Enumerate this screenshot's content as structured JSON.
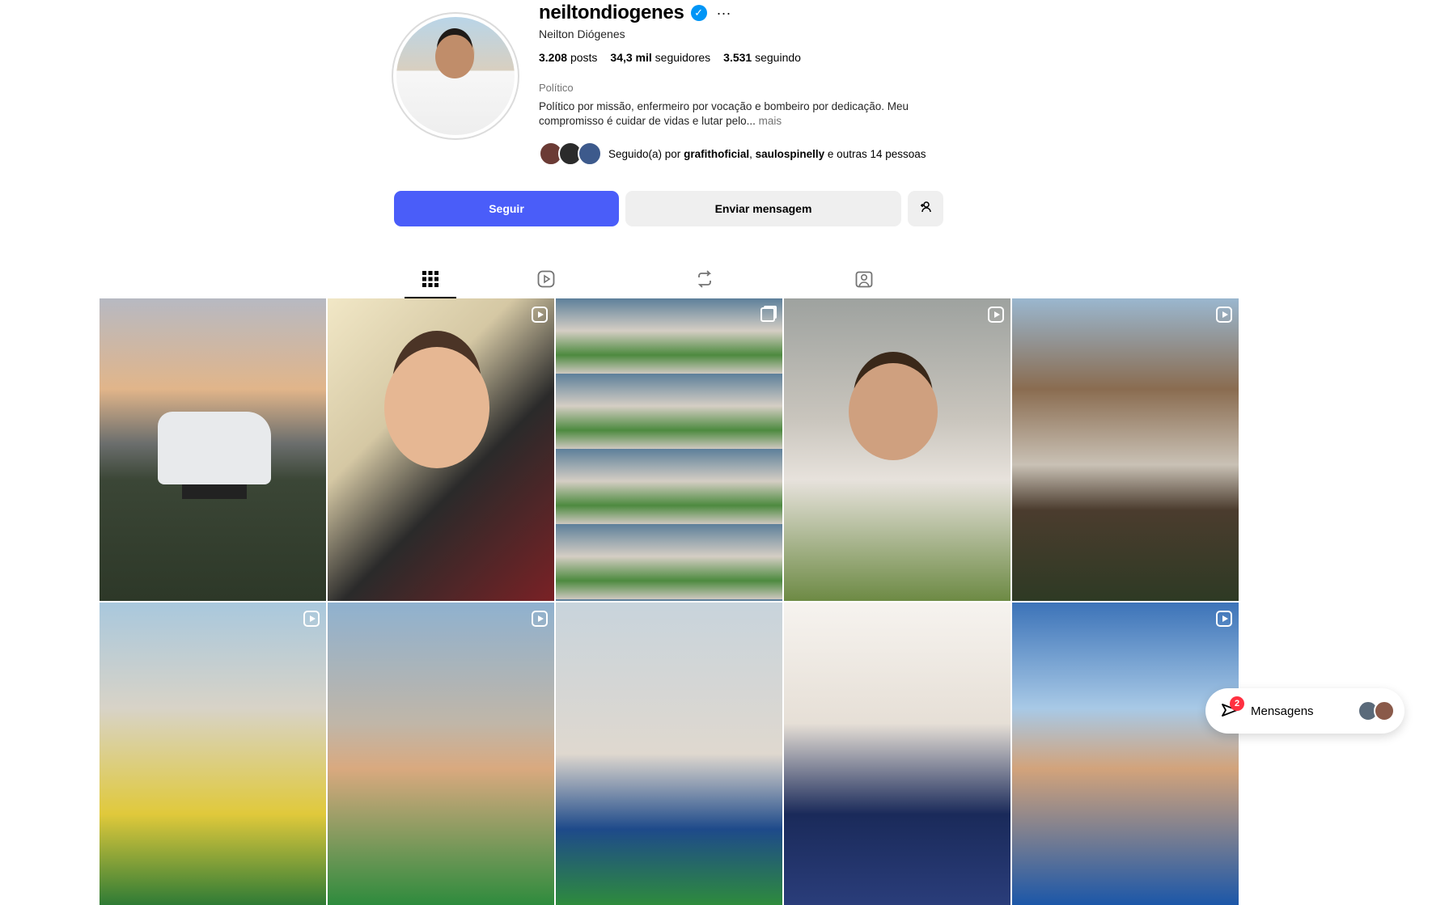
{
  "profile": {
    "username": "neiltondiogenes",
    "full_name": "Neilton Diógenes",
    "stats": [
      {
        "value": "3.208",
        "label": "posts"
      },
      {
        "value": "34,3 mil",
        "label": "seguidores"
      },
      {
        "value": "3.531",
        "label": "seguindo"
      }
    ],
    "category": "Político",
    "bio": "Político por missão, enfermeiro por vocação e bombeiro por dedicação. Meu compromisso é cuidar de vidas e lutar pelo...",
    "bio_more": "mais",
    "followed_by": {
      "prefix": "Seguido(a) por",
      "user1": "grafithoficial",
      "sep": ",",
      "user2": "saulospinelly",
      "suffix": "e outras 14 pessoas"
    }
  },
  "actions": {
    "follow": "Seguir",
    "message": "Enviar mensagem",
    "suggest_icon": "person-add-icon"
  },
  "tabs": [
    {
      "icon": "grid-icon",
      "active": true
    },
    {
      "icon": "reels-icon",
      "active": false
    },
    {
      "icon": "reposts-icon",
      "active": false
    },
    {
      "icon": "tagged-icon",
      "active": false
    }
  ],
  "posts": [
    {
      "type": "photo"
    },
    {
      "type": "reel"
    },
    {
      "type": "carousel"
    },
    {
      "type": "reel"
    },
    {
      "type": "reel"
    },
    {
      "type": "reel"
    },
    {
      "type": "reel"
    },
    {
      "type": "photo"
    },
    {
      "type": "photo"
    },
    {
      "type": "reel"
    }
  ],
  "messages_pill": {
    "label": "Mensagens",
    "unread": "2"
  },
  "colors": {
    "follow_button": "#4a5df9",
    "secondary_button": "#efefef",
    "verified": "#0095f6",
    "badge": "#ff3040"
  }
}
